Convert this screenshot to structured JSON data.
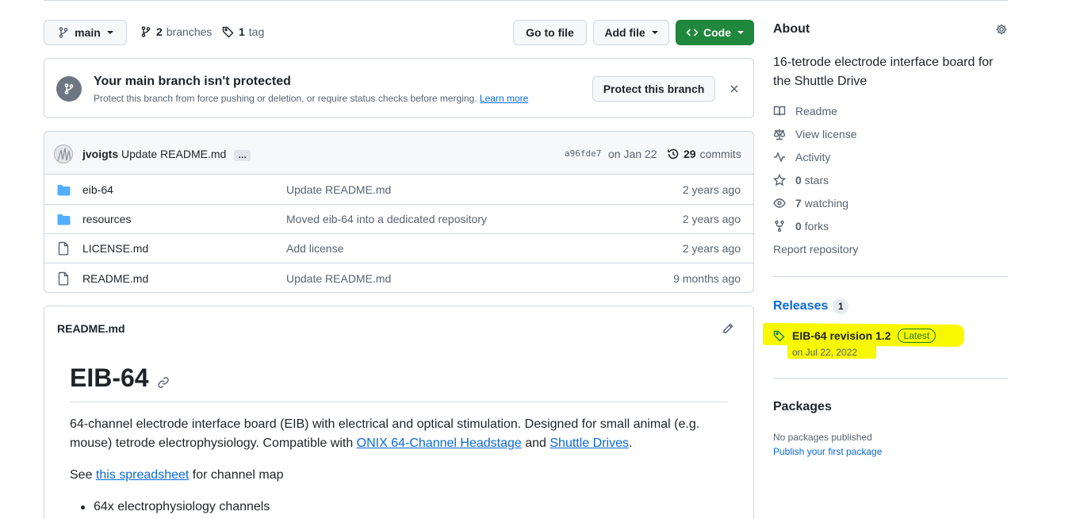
{
  "toolbar": {
    "branch": "main",
    "branches_count": "2",
    "branches_label": "branches",
    "tags_count": "1",
    "tags_label": "tag",
    "go_to_file": "Go to file",
    "add_file": "Add file",
    "code": "Code"
  },
  "protection_banner": {
    "title": "Your main branch isn't protected",
    "description": "Protect this branch from force pushing or deletion, or require status checks before merging.",
    "learn_more": "Learn more",
    "button": "Protect this branch"
  },
  "commit": {
    "author": "jvoigts",
    "message": "Update README.md",
    "ellipsis": "…",
    "sha": "a96fde7",
    "date": "on Jan 22",
    "commits_count": "29",
    "commits_label": "commits"
  },
  "files": [
    {
      "type": "folder",
      "name": "eib-64",
      "message": "Update README.md",
      "date": "2 years ago"
    },
    {
      "type": "folder",
      "name": "resources",
      "message": "Moved eib-64 into a dedicated repository",
      "date": "2 years ago"
    },
    {
      "type": "file",
      "name": "LICENSE.md",
      "message": "Add license",
      "date": "2 years ago"
    },
    {
      "type": "file",
      "name": "README.md",
      "message": "Update README.md",
      "date": "9 months ago"
    }
  ],
  "readme": {
    "filename": "README.md",
    "heading": "EIB-64",
    "para1_text": "64-channel electrode interface board (EIB) with electrical and optical stimulation. Designed for small animal (e.g. mouse) tetrode electrophysiology. Compatible with ",
    "para1_link1": "ONIX 64-Channel Headstage",
    "para1_and": " and ",
    "para1_link2": "Shuttle Drives",
    "para1_end": ".",
    "para2_pre": "See ",
    "para2_link": "this spreadsheet",
    "para2_post": " for channel map",
    "bullet1": "64x electrophysiology channels"
  },
  "about": {
    "title": "About",
    "description": "16-tetrode electrode interface board for the Shuttle Drive",
    "readme": "Readme",
    "license": "View license",
    "activity": "Activity",
    "stars_count": "0",
    "stars_label": "stars",
    "watching_count": "7",
    "watching_label": "watching",
    "forks_count": "0",
    "forks_label": "forks",
    "report": "Report repository"
  },
  "releases": {
    "title": "Releases",
    "count": "1",
    "latest_name": "EIB-64 revision 1.2",
    "latest_badge": "Latest",
    "latest_date": "on Jul 22, 2022",
    "highlight_color": "#f8f800"
  },
  "packages": {
    "title": "Packages",
    "none": "No packages published",
    "publish": "Publish your first package"
  },
  "colors": {
    "accent": "#0969da",
    "green_button": "#1f883d",
    "folder": "#54aeff",
    "muted": "#59636e",
    "border": "#d0d7de"
  }
}
